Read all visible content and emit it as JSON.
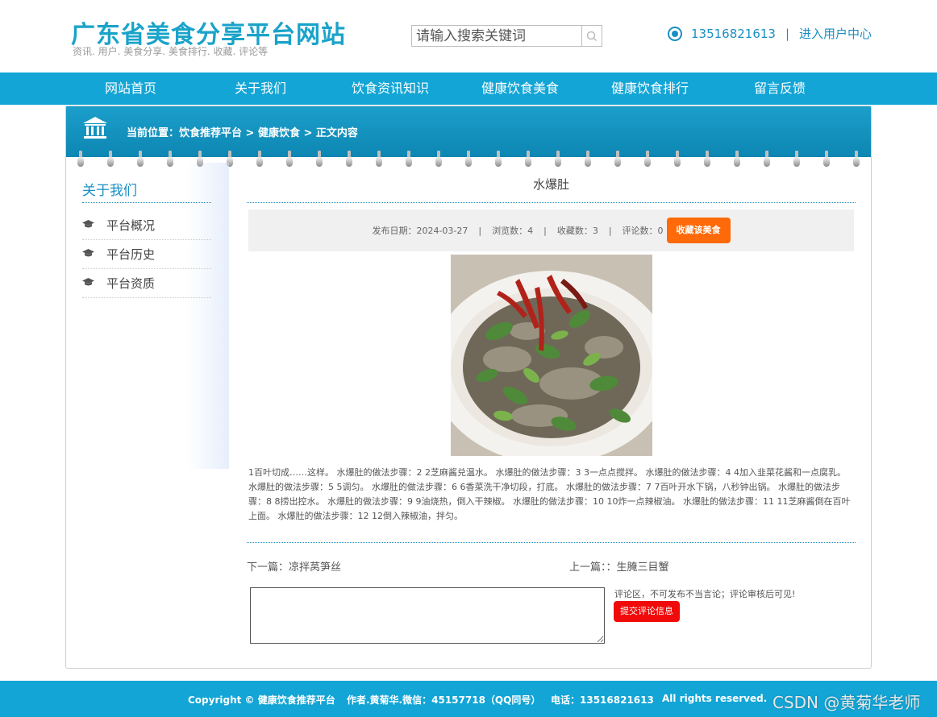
{
  "header": {
    "title": "广东省美食分享平台网站",
    "subtitle": "资讯. 用户. 美食分享. 美食排行. 收藏. 评论等",
    "search_placeholder": "请输入搜索关键词",
    "search_icon": "search-icon",
    "phone": "13516821613",
    "separator": "|",
    "user_center": "进入用户中心",
    "accent_color": "#1aa3c9"
  },
  "nav": {
    "items": [
      {
        "label": "网站首页"
      },
      {
        "label": "关于我们"
      },
      {
        "label": "饮食资讯知识"
      },
      {
        "label": "健康饮食美食"
      },
      {
        "label": "健康饮食排行"
      },
      {
        "label": "留言反馈"
      }
    ],
    "background": "#12a5d6"
  },
  "breadcrumb": {
    "icon": "bank-icon",
    "text": "当前位置：饮食推荐平台 > 健康饮食 > 正文内容"
  },
  "sidebar": {
    "title": "关于我们",
    "items": [
      {
        "label": "平台概况",
        "icon": "graduation-cap-icon"
      },
      {
        "label": "平台历史",
        "icon": "graduation-cap-icon"
      },
      {
        "label": "平台资质",
        "icon": "graduation-cap-icon"
      }
    ]
  },
  "article": {
    "title": "水爆肚",
    "meta": {
      "date": "发布日期：2024-03-27",
      "views": "浏览数：4",
      "favorites": "收藏数：3",
      "comments": "评论数：0",
      "separator": "|"
    },
    "favorite_button": "收藏该美食",
    "favorite_color": "#fe6a0a",
    "body": "1百叶切成……这样。 水爆肚的做法步骤：2 2芝麻酱兑温水。 水爆肚的做法步骤：3 3一点点搅拌。 水爆肚的做法步骤：4 4加入韭菜花酱和一点腐乳。 水爆肚的做法步骤：5 5调匀。 水爆肚的做法步骤：6 6香菜洗干净切段，打底。 水爆肚的做法步骤：7 7百叶开水下锅，八秒钟出锅。 水爆肚的做法步骤：8 8捞出控水。 水爆肚的做法步骤：9 9油烧热，倒入干辣椒。 水爆肚的做法步骤：10 10炸一点辣椒油。 水爆肚的做法步骤：11 11芝麻酱倒在百叶上面。 水爆肚的做法步骤：12 12倒入辣椒油，拌匀。",
    "next": "下一篇：凉拌莴笋丝",
    "prev": "上一篇：：生腌三目蟹"
  },
  "comment": {
    "note": "评论区，不可发布不当言论；评论审核后可见!",
    "submit": "提交评论信息",
    "submit_color": "#f00a0a"
  },
  "footer": {
    "copyright": "Copyright © 健康饮食推荐平台",
    "author": "作者.黄菊华.微信：45157718（QQ同号）",
    "phone": "电话：13516821613",
    "rights": "All rights reserved.",
    "watermark": "CSDN @黄菊华老师"
  }
}
